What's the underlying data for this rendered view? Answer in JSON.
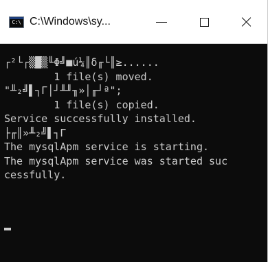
{
  "window": {
    "title": "C:\\Windows\\sy...",
    "icon_text": "C:\\",
    "icon": "command-prompt-icon",
    "controls": {
      "minimize_icon": "minimize-icon",
      "maximize_icon": "maximize-icon",
      "close_icon": "close-icon"
    }
  },
  "console": {
    "lines": [
      "┌²└┌▒█▒╙Φ╝■ú¼║δ╓└║≥......",
      "        1 file(s) moved.",
      "\"╨₂╝▌┐Γ│┘╨╜╖»│╓┘ª\";",
      "        1 file(s) copied.",
      "Service successfully installed.",
      "├╓║»╨₂╝▌┐Γ",
      "The mysqlApm service is starting.",
      "The mysqlApm service was started suc",
      "cessfully."
    ],
    "colors": {
      "background": "#0c0c0c",
      "text": "#cccccc"
    }
  }
}
